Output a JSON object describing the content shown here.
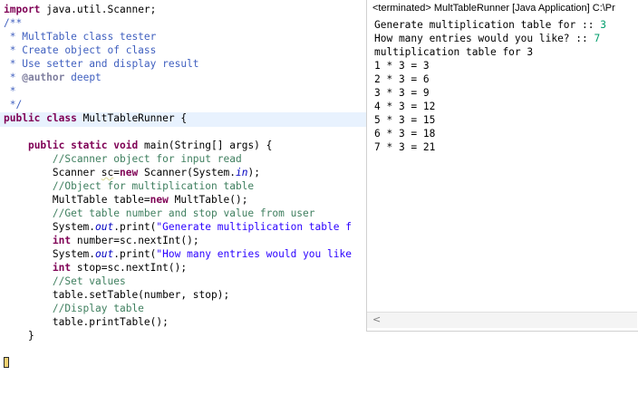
{
  "editor": {
    "lines": [
      [
        {
          "t": "import",
          "c": "kw"
        },
        {
          "t": " java.util.Scanner;",
          "c": ""
        }
      ],
      [
        {
          "t": "/**",
          "c": "jd"
        }
      ],
      [
        {
          "t": " * MultTable class tester",
          "c": "jd"
        }
      ],
      [
        {
          "t": " * Create object of class",
          "c": "jd"
        }
      ],
      [
        {
          "t": " * Use setter and display result",
          "c": "jd"
        }
      ],
      [
        {
          "t": " * ",
          "c": "jd"
        },
        {
          "t": "@author",
          "c": "tag"
        },
        {
          "t": " deept",
          "c": "jd"
        }
      ],
      [
        {
          "t": " *",
          "c": "jd"
        }
      ],
      [
        {
          "t": " */",
          "c": "jd"
        }
      ],
      [
        {
          "t": "public class",
          "c": "kw"
        },
        {
          "t": " MultTableRunner {",
          "c": ""
        }
      ],
      [
        {
          "t": "",
          "c": ""
        }
      ],
      [
        {
          "t": "    ",
          "c": ""
        },
        {
          "t": "public static void",
          "c": "kw"
        },
        {
          "t": " main(String[] args) {",
          "c": ""
        }
      ],
      [
        {
          "t": "        //Scanner object for input read",
          "c": "cm"
        }
      ],
      [
        {
          "t": "        Scanner ",
          "c": ""
        },
        {
          "t": "sc",
          "c": "err"
        },
        {
          "t": "=",
          "c": ""
        },
        {
          "t": "new",
          "c": "kw"
        },
        {
          "t": " Scanner(System.",
          "c": ""
        },
        {
          "t": "in",
          "c": "fld"
        },
        {
          "t": ");",
          "c": ""
        }
      ],
      [
        {
          "t": "        //Object for multiplication table",
          "c": "cm"
        }
      ],
      [
        {
          "t": "        MultTable table=",
          "c": ""
        },
        {
          "t": "new",
          "c": "kw"
        },
        {
          "t": " MultTable();",
          "c": ""
        }
      ],
      [
        {
          "t": "        //Get table number and stop value from user",
          "c": "cm"
        }
      ],
      [
        {
          "t": "        System.",
          "c": ""
        },
        {
          "t": "out",
          "c": "fld"
        },
        {
          "t": ".print(",
          "c": ""
        },
        {
          "t": "\"Generate multiplication table f",
          "c": "str"
        }
      ],
      [
        {
          "t": "        ",
          "c": ""
        },
        {
          "t": "int",
          "c": "kw"
        },
        {
          "t": " number=sc.nextInt();",
          "c": ""
        }
      ],
      [
        {
          "t": "        System.",
          "c": ""
        },
        {
          "t": "out",
          "c": "fld"
        },
        {
          "t": ".print(",
          "c": ""
        },
        {
          "t": "\"How many entries would you like",
          "c": "str"
        }
      ],
      [
        {
          "t": "        ",
          "c": ""
        },
        {
          "t": "int",
          "c": "kw"
        },
        {
          "t": " stop=sc.nextInt();",
          "c": ""
        }
      ],
      [
        {
          "t": "        //Set values",
          "c": "cm"
        }
      ],
      [
        {
          "t": "        table.setTable(number, stop);",
          "c": ""
        }
      ],
      [
        {
          "t": "        //Display table",
          "c": "cm"
        }
      ],
      [
        {
          "t": "        table.printTable();",
          "c": ""
        }
      ],
      [
        {
          "t": "    }",
          "c": ""
        }
      ]
    ]
  },
  "console": {
    "header": "<terminated> MultTableRunner [Java Application] C:\\Pr",
    "lines": [
      [
        {
          "t": "Generate multiplication table for :: ",
          "c": ""
        },
        {
          "t": "3",
          "c": "in"
        }
      ],
      [
        {
          "t": "How many entries would you like? :: ",
          "c": ""
        },
        {
          "t": "7",
          "c": "in"
        }
      ],
      [
        {
          "t": "multiplication table for 3",
          "c": ""
        }
      ],
      [
        {
          "t": "1 * 3 = 3",
          "c": ""
        }
      ],
      [
        {
          "t": "2 * 3 = 6",
          "c": ""
        }
      ],
      [
        {
          "t": "3 * 3 = 9",
          "c": ""
        }
      ],
      [
        {
          "t": "4 * 3 = 12",
          "c": ""
        }
      ],
      [
        {
          "t": "5 * 3 = 15",
          "c": ""
        }
      ],
      [
        {
          "t": "6 * 3 = 18",
          "c": ""
        }
      ],
      [
        {
          "t": "7 * 3 = 21",
          "c": ""
        }
      ]
    ],
    "scroll_left_icon": "<"
  }
}
